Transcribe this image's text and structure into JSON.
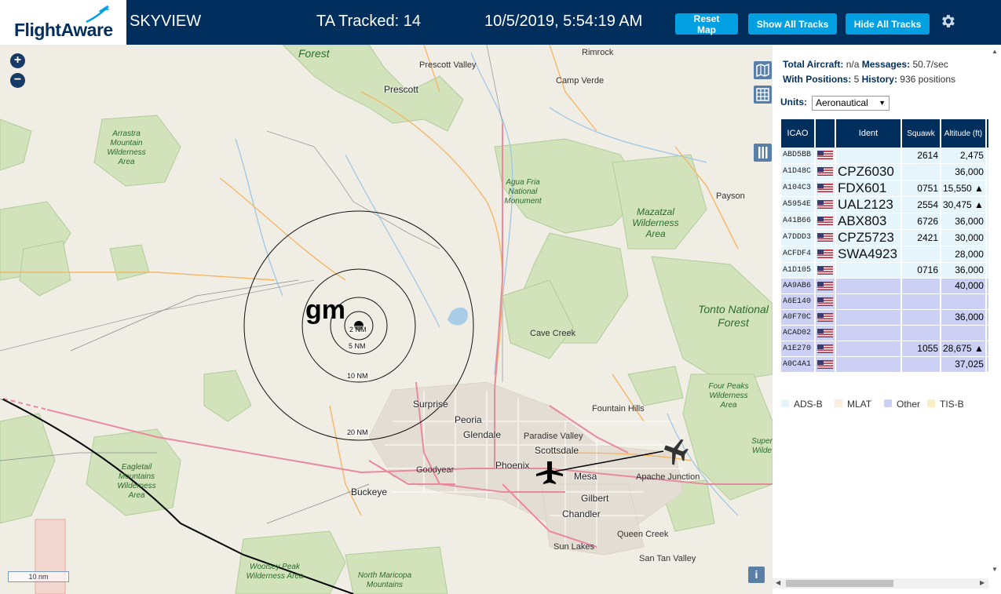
{
  "header": {
    "logo_text": "FlightAware",
    "site": "SKYVIEW",
    "tracked": "TA Tracked: 14",
    "datetime": "10/5/2019, 5:54:19 AM",
    "buttons": {
      "reset_map": "Reset Map",
      "show_all": "Show All Tracks",
      "hide_all": "Hide All Tracks"
    },
    "icons": {
      "settings": "gear-icon",
      "logo": "airplane-logo-icon"
    }
  },
  "map": {
    "labels": {
      "forest_top": "Forest",
      "rimrock": "Rimrock",
      "prescott_valley": "Prescott Valley",
      "camp_verde": "Camp Verde",
      "prescott": "Prescott",
      "arrastra": "Arrastra Mountain Wilderness Area",
      "agua_fria": "Agua Fria National Monument",
      "payson": "Payson",
      "mazatzal": "Mazatzal Wilderness Area",
      "tonto": "Tonto National Forest",
      "cave_creek": "Cave Creek",
      "four_peaks": "Four Peaks Wilderness Area",
      "fountain_hills": "Fountain Hills",
      "surprise": "Surprise",
      "peoria": "Peoria",
      "glendale": "Glendale",
      "paradise_valley": "Paradise Valley",
      "scottsdale": "Scottsdale",
      "superstition": "Super Wilde",
      "goodyear": "Goodyear",
      "phoenix": "Phoenix",
      "mesa": "Mesa",
      "apache_junction": "Apache Junction",
      "eagletail": "Eagletail Mountains Wilderness Area",
      "buckeye": "Buckeye",
      "gilbert": "Gilbert",
      "chandler": "Chandler",
      "queen_creek": "Queen Creek",
      "sun_lakes": "Sun Lakes",
      "san_tan_valley": "San Tan Valley",
      "woolsey": "Woolsey Peak Wilderness Area",
      "north_maricopa": "North Maricopa Mountains"
    },
    "receiver_label": "gm",
    "range_rings": [
      "2 NM",
      "5 NM",
      "10 NM",
      "20 NM"
    ],
    "scale": "10 nm",
    "zoom_in": "+",
    "zoom_out": "−",
    "info": "i"
  },
  "sidebar": {
    "stats": {
      "total_aircraft_label": "Total Aircraft:",
      "total_aircraft_value": "n/a",
      "messages_label": "Messages:",
      "messages_value": "50.7/sec",
      "with_positions_label": "With Positions:",
      "with_positions_value": "5",
      "history_label": "History:",
      "history_value": "936 positions"
    },
    "units_label": "Units:",
    "units_value": "Aeronautical",
    "table": {
      "headers": [
        "ICAO",
        "",
        "Ident",
        "Squawk",
        "Altitude (ft)"
      ],
      "rows": [
        {
          "icao": "ABD5BB",
          "ident": "",
          "squawk": "2614",
          "alt": "2,475",
          "type": "adsb"
        },
        {
          "icao": "A1D48C",
          "ident": "CPZ6030",
          "squawk": "",
          "alt": "36,000",
          "type": "adsb"
        },
        {
          "icao": "A104C3",
          "ident": "FDX601",
          "squawk": "0751",
          "alt": "15,550 ▲",
          "type": "adsb"
        },
        {
          "icao": "A5954E",
          "ident": "UAL2123",
          "squawk": "2554",
          "alt": "30,475 ▲",
          "type": "adsb"
        },
        {
          "icao": "A41B66",
          "ident": "ABX803",
          "squawk": "6726",
          "alt": "36,000",
          "type": "adsb"
        },
        {
          "icao": "A7DDD3",
          "ident": "CPZ5723",
          "squawk": "2421",
          "alt": "30,000",
          "type": "adsb"
        },
        {
          "icao": "ACFDF4",
          "ident": "SWA4923",
          "squawk": "",
          "alt": "28,000",
          "type": "adsb"
        },
        {
          "icao": "A1D105",
          "ident": "",
          "squawk": "0716",
          "alt": "36,000",
          "type": "adsb"
        },
        {
          "icao": "AA9AB6",
          "ident": "",
          "squawk": "",
          "alt": "40,000",
          "type": "other"
        },
        {
          "icao": "A6E140",
          "ident": "",
          "squawk": "",
          "alt": "",
          "type": "other"
        },
        {
          "icao": "A0F70C",
          "ident": "",
          "squawk": "",
          "alt": "36,000",
          "type": "other"
        },
        {
          "icao": "ACAD02",
          "ident": "",
          "squawk": "",
          "alt": "",
          "type": "other"
        },
        {
          "icao": "A1E270",
          "ident": "",
          "squawk": "1055",
          "alt": "28,675 ▲",
          "type": "other"
        },
        {
          "icao": "A0C4A1",
          "ident": "",
          "squawk": "",
          "alt": "37,025",
          "type": "other"
        }
      ]
    },
    "legend": [
      {
        "label": "ADS-B",
        "color": "#e6f4fb"
      },
      {
        "label": "MLAT",
        "color": "#faeedd"
      },
      {
        "label": "Other",
        "color": "#cbd0f4"
      },
      {
        "label": "TIS-B",
        "color": "#fbefc4"
      }
    ]
  }
}
